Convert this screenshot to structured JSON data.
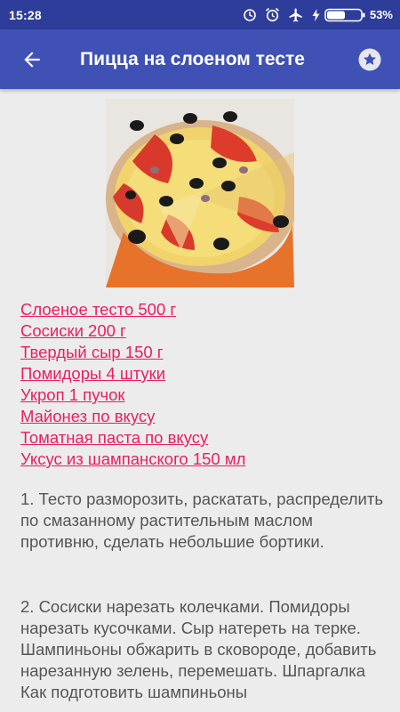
{
  "status_bar": {
    "time": "15:28",
    "battery_percent": "53%",
    "icons": [
      "sync-icon",
      "alarm-icon",
      "airplane-mode-icon",
      "charging-icon",
      "battery-icon"
    ],
    "battery_level": 0.53
  },
  "app_bar": {
    "title": "Пицца на слоеном тесте",
    "back_icon": "arrow-back-icon",
    "favorite_icon": "star-icon"
  },
  "colors": {
    "status_bar": "#2e3d9a",
    "app_bar": "#3f51b5",
    "link": "#e91e63",
    "body_text": "#555555",
    "background": "#ececec"
  },
  "recipe": {
    "ingredients": [
      "Слоеное тесто 500 г",
      "Сосиски 200 г",
      "Твердый сыр 150 г",
      "Помидоры 4 штуки",
      "Укроп 1 пучок",
      "Майонез по вкусу",
      "Томатная паста по вкусу",
      "Уксус из шампанского 150 мл"
    ],
    "steps": [
      "1. Тесто разморозить, раскатать, распределить по смазанному растительным маслом противню, сделать небольшие бортики.",
      "2. Сосиски нарезать колечками. Помидоры нарезать кусочками. Сыр натереть на терке. Шампиньоны обжарить в сковороде, добавить нарезанную зелень, перемешать. Шпаргалка Как подготовить шампиньоны"
    ]
  }
}
